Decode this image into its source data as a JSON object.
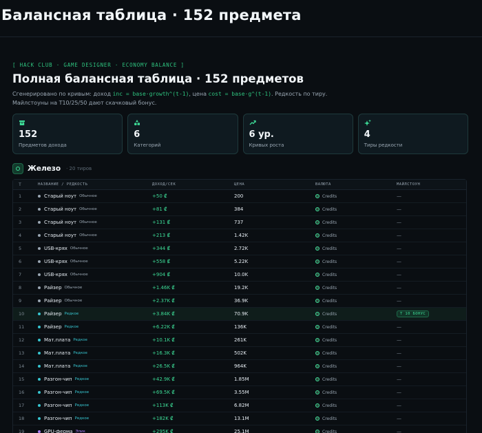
{
  "page": {
    "title": "Балансная таблица · 152 предмета"
  },
  "header": {
    "eyebrow": "[ HACK CLUB · GAME DESIGNER · ECONOMY BALANCE ]",
    "title": "Полная балансная таблица · 152 предметов",
    "subtitle_prefix": "Сгенерировано по кривым: доход ",
    "subtitle_code1": "inc = base·growth^(t-1)",
    "subtitle_mid": ", цена ",
    "subtitle_code2": "cost = base·g^(t-1)",
    "subtitle_suffix": ". Редкость по тиру. Майлстоуны на T10/25/50 дают скачковый бонус."
  },
  "stats": [
    {
      "icon": "box-icon",
      "value": "152",
      "label": "Предметов дохода"
    },
    {
      "icon": "shapes-icon",
      "value": "6",
      "label": "Категорий"
    },
    {
      "icon": "trend-up-icon",
      "value": "6 ур.",
      "label": "Кривых роста"
    },
    {
      "icon": "sparkle-icon",
      "value": "4",
      "label": "Тиры редкости"
    }
  ],
  "section": {
    "title": "Железо",
    "count": "· 20 тиров"
  },
  "table": {
    "headers": {
      "tier": "T",
      "name": "НАЗВАНИЕ / РЕДКОСТЬ",
      "income": "ДОХОД/СЕК",
      "cost": "ЦЕНА",
      "currency": "ВАЛЮТА",
      "milestone": "МАЙЛСТОУН"
    },
    "rows": [
      {
        "tier": "1",
        "name": "Старый ноут",
        "rarity": "Обычное",
        "income": "+50 ₡",
        "cost": "200",
        "currency": "Credits",
        "milestone": "—"
      },
      {
        "tier": "2",
        "name": "Старый ноут",
        "rarity": "Обычное",
        "income": "+81 ₡",
        "cost": "384",
        "currency": "Credits",
        "milestone": "—"
      },
      {
        "tier": "3",
        "name": "Старый ноут",
        "rarity": "Обычное",
        "income": "+131 ₡",
        "cost": "737",
        "currency": "Credits",
        "milestone": "—"
      },
      {
        "tier": "4",
        "name": "Старый ноут",
        "rarity": "Обычное",
        "income": "+213 ₡",
        "cost": "1.42K",
        "currency": "Credits",
        "milestone": "—"
      },
      {
        "tier": "5",
        "name": "USB-крях",
        "rarity": "Обычное",
        "income": "+344 ₡",
        "cost": "2.72K",
        "currency": "Credits",
        "milestone": "—"
      },
      {
        "tier": "6",
        "name": "USB-крях",
        "rarity": "Обычное",
        "income": "+558 ₡",
        "cost": "5.22K",
        "currency": "Credits",
        "milestone": "—"
      },
      {
        "tier": "7",
        "name": "USB-крях",
        "rarity": "Обычное",
        "income": "+904 ₡",
        "cost": "10.0K",
        "currency": "Credits",
        "milestone": "—"
      },
      {
        "tier": "8",
        "name": "Райзер",
        "rarity": "Обычное",
        "income": "+1.46K ₡",
        "cost": "19.2K",
        "currency": "Credits",
        "milestone": "—"
      },
      {
        "tier": "9",
        "name": "Райзер",
        "rarity": "Обычное",
        "income": "+2.37K ₡",
        "cost": "36.9K",
        "currency": "Credits",
        "milestone": "—"
      },
      {
        "tier": "10",
        "name": "Райзер",
        "rarity": "Редкое",
        "income": "+3.84K ₡",
        "cost": "70.9K",
        "currency": "Credits",
        "milestone": "T 10 БОНУС",
        "highlight": true
      },
      {
        "tier": "11",
        "name": "Райзер",
        "rarity": "Редкое",
        "income": "+6.22K ₡",
        "cost": "136K",
        "currency": "Credits",
        "milestone": "—"
      },
      {
        "tier": "12",
        "name": "Мат.плата",
        "rarity": "Редкое",
        "income": "+10.1K ₡",
        "cost": "261K",
        "currency": "Credits",
        "milestone": "—"
      },
      {
        "tier": "13",
        "name": "Мат.плата",
        "rarity": "Редкое",
        "income": "+16.3K ₡",
        "cost": "502K",
        "currency": "Credits",
        "milestone": "—"
      },
      {
        "tier": "14",
        "name": "Мат.плата",
        "rarity": "Редкое",
        "income": "+26.5K ₡",
        "cost": "964K",
        "currency": "Credits",
        "milestone": "—"
      },
      {
        "tier": "15",
        "name": "Разгон-чип",
        "rarity": "Редкое",
        "income": "+42.9K ₡",
        "cost": "1.85M",
        "currency": "Credits",
        "milestone": "—"
      },
      {
        "tier": "16",
        "name": "Разгон-чип",
        "rarity": "Редкое",
        "income": "+69.5K ₡",
        "cost": "3.55M",
        "currency": "Credits",
        "milestone": "—"
      },
      {
        "tier": "17",
        "name": "Разгон-чип",
        "rarity": "Редкое",
        "income": "+113K ₡",
        "cost": "6.82M",
        "currency": "Credits",
        "milestone": "—"
      },
      {
        "tier": "18",
        "name": "Разгон-чип",
        "rarity": "Редкое",
        "income": "+182K ₡",
        "cost": "13.1M",
        "currency": "Credits",
        "milestone": "—"
      },
      {
        "tier": "19",
        "name": "GPU-ферма",
        "rarity": "Эпик",
        "income": "+295K ₡",
        "cost": "25.1M",
        "currency": "Credits",
        "milestone": "—"
      }
    ]
  },
  "colors": {
    "accent": "#3ddc97",
    "rarity_common": "#9aa7b3",
    "rarity_rare": "#37c5d0",
    "rarity_epic": "#a77bf3"
  }
}
